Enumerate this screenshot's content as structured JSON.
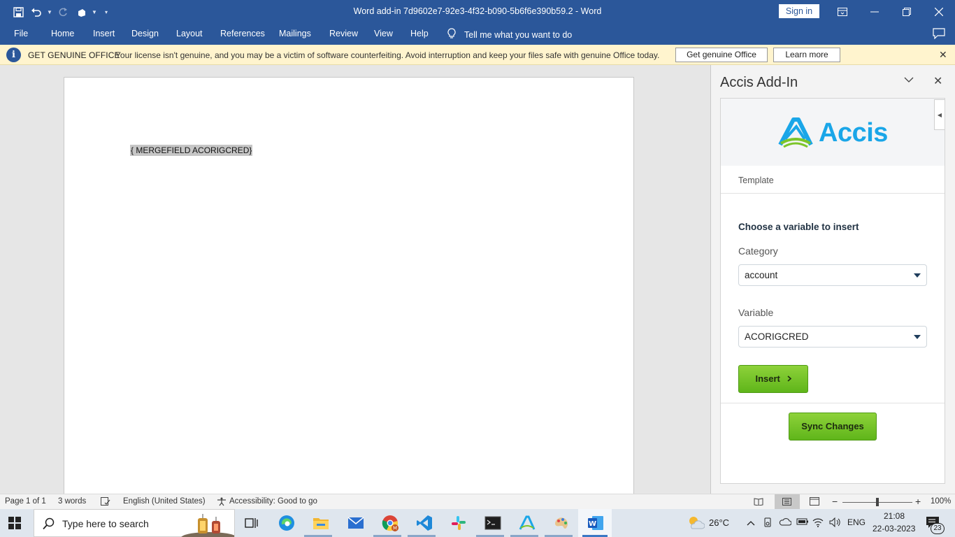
{
  "window": {
    "title": "Word add-in 7d9602e7-92e3-4f32-b090-5b6f6e390b59.2  -  Word",
    "sign_in": "Sign in"
  },
  "ribbon": {
    "tabs": [
      "File",
      "Home",
      "Insert",
      "Design",
      "Layout",
      "References",
      "Mailings",
      "Review",
      "View",
      "Help"
    ],
    "tell_me": "Tell me what you want to do"
  },
  "message_bar": {
    "title": "GET GENUINE OFFICE",
    "text": "Your license isn't genuine, and you may be a victim of software counterfeiting. Avoid interruption and keep your files safe with genuine Office today.",
    "get_button": "Get genuine Office",
    "learn_button": "Learn more"
  },
  "document": {
    "field_code": "{ MERGEFIELD ACORIGCRED}"
  },
  "task_pane": {
    "title": "Accis Add-In",
    "logo_text": "Accis",
    "section": "Template",
    "instruction": "Choose a variable to insert",
    "category_label": "Category",
    "category_value": "account",
    "variable_label": "Variable",
    "variable_value": "ACORIGCRED",
    "insert_button": "Insert",
    "sync_button": "Sync Changes",
    "brand_blue": "#1aa6e8",
    "brand_green": "#6cc417"
  },
  "status_bar": {
    "page": "Page 1 of 1",
    "words": "3 words",
    "language": "English (United States)",
    "accessibility": "Accessibility: Good to go",
    "zoom": "100%"
  },
  "taskbar": {
    "search_placeholder": "Type here to search",
    "temperature": "26°C",
    "language": "ENG",
    "time": "21:08",
    "date": "22-03-2023",
    "notifications": "23"
  },
  "colors": {
    "word_blue": "#2b579a",
    "message_bar": "#fff4ce"
  }
}
